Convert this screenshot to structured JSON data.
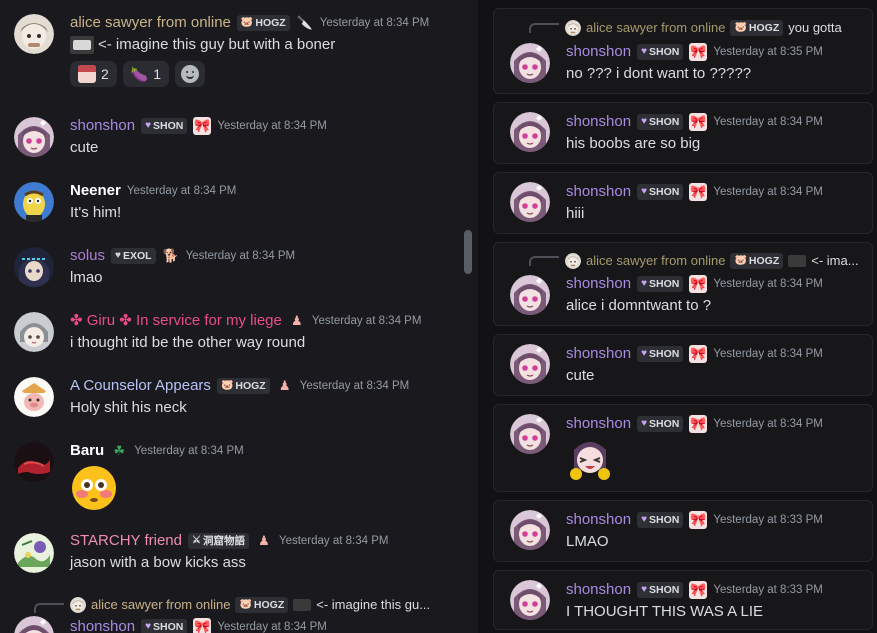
{
  "left": {
    "messages": [
      {
        "name": "alice sawyer from online",
        "name_color": "#c9b48a",
        "tag": "HOGZ",
        "time": "Yesterday at 8:34 PM",
        "text": "<- imagine this guy but with a boner",
        "reactions": [
          {
            "count": "2"
          },
          {
            "count": "1"
          }
        ]
      },
      {
        "name": "shonshon",
        "name_color": "#a78be3",
        "tag": "SHON",
        "time": "Yesterday at 8:34 PM",
        "text": "cute"
      },
      {
        "name": "Neener",
        "name_color": "#ffffff",
        "time": "Yesterday at 8:34 PM",
        "text": "It's him!"
      },
      {
        "name": "solus",
        "name_color": "#b07ad6",
        "tag": "EXOL",
        "time": "Yesterday at 8:34 PM",
        "text": "lmao"
      },
      {
        "name": "✤ Giru ✤ In service for my liege",
        "name_color": "#e84c8a",
        "time": "Yesterday at 8:34 PM",
        "text": "i thought itd be the other way round"
      },
      {
        "name": "A Counselor Appears",
        "name_color": "#b6c3f5",
        "tag": "HOGZ",
        "time": "Yesterday at 8:34 PM",
        "text": "Holy shit his neck"
      },
      {
        "name": "Baru",
        "name_color": "#ffffff",
        "time": "Yesterday at 8:34 PM"
      },
      {
        "name": "STARCHY friend",
        "name_color": "#f08cb0",
        "tag": "洞窟物語",
        "time": "Yesterday at 8:34 PM",
        "text": "jason with a bow kicks ass"
      },
      {
        "name": "shonshon",
        "name_color": "#a78be3",
        "tag": "SHON",
        "time": "Yesterday at 8:34 PM",
        "reply": {
          "name": "alice sawyer from online",
          "tag": "HOGZ",
          "text": "<- imagine this gu..."
        }
      }
    ]
  },
  "right": {
    "messages": [
      {
        "name": "shonshon",
        "tag": "SHON",
        "time": "Yesterday at 8:35 PM",
        "text": "no ??? i dont want to ?????",
        "reply": {
          "name": "alice sawyer from online",
          "tag": "HOGZ",
          "text": "you gotta"
        }
      },
      {
        "name": "shonshon",
        "tag": "SHON",
        "time": "Yesterday at 8:34 PM",
        "text": "his boobs are so big"
      },
      {
        "name": "shonshon",
        "tag": "SHON",
        "time": "Yesterday at 8:34 PM",
        "text": "hiii"
      },
      {
        "name": "shonshon",
        "tag": "SHON",
        "time": "Yesterday at 8:34 PM",
        "text": "alice i domntwant to ?",
        "reply": {
          "name": "alice sawyer from online",
          "tag": "HOGZ",
          "text": "<- ima..."
        }
      },
      {
        "name": "shonshon",
        "tag": "SHON",
        "time": "Yesterday at 8:34 PM",
        "text": "cute"
      },
      {
        "name": "shonshon",
        "tag": "SHON",
        "time": "Yesterday at 8:34 PM"
      },
      {
        "name": "shonshon",
        "tag": "SHON",
        "time": "Yesterday at 8:33 PM",
        "text": "LMAO"
      },
      {
        "name": "shonshon",
        "tag": "SHON",
        "time": "Yesterday at 8:33 PM",
        "text": "I THOUGHT THIS WAS A LIE"
      }
    ]
  },
  "colors": {
    "shon": "#a78be3",
    "alice": "#c9b48a",
    "muted": "#949ba4"
  },
  "icons": [
    "knife-icon",
    "heart-tag-icon",
    "pig-tag-icon",
    "clover-icon",
    "smiley-add-icon",
    "eggplant-icon",
    "flushed-emoji",
    "anime-sticker"
  ]
}
